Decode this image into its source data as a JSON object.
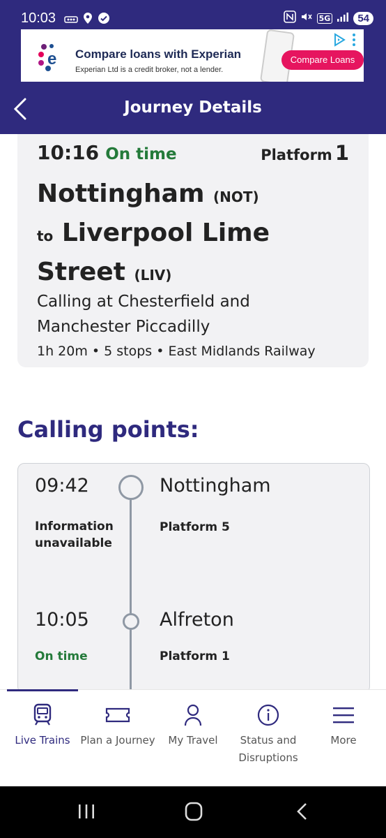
{
  "status_bar": {
    "time": "10:03",
    "battery": "54",
    "network": "5G"
  },
  "ad": {
    "title": "Compare loans with Experian",
    "subtitle": "Experian Ltd is a credit broker, not a lender.",
    "cta": "Compare Loans"
  },
  "header": {
    "title": "Journey Details"
  },
  "journey": {
    "departure_time": "10:16",
    "status": "On time",
    "platform_label": "Platform",
    "platform_number": "1",
    "origin": "Nottingham",
    "origin_code": "(NOT)",
    "to_word": "to",
    "destination": "Liverpool Lime Street",
    "destination_code": "(LIV)",
    "calling_at": "Calling at Chesterfield and Manchester Piccadilly",
    "meta": "1h 20m • 5 stops • East Midlands Railway"
  },
  "calling_points": {
    "heading": "Calling points:",
    "stops": [
      {
        "time": "09:42",
        "status": "Information unavailable",
        "name": "Nottingham",
        "platform": "Platform 5"
      },
      {
        "time": "10:05",
        "status": "On time",
        "name": "Alfreton",
        "platform": "Platform 1"
      }
    ]
  },
  "bottom_nav": {
    "items": [
      {
        "label": "Live Trains",
        "icon": "train-icon",
        "active": true
      },
      {
        "label": "Plan a Journey",
        "icon": "ticket-icon",
        "active": false
      },
      {
        "label": "My Travel",
        "icon": "person-icon",
        "active": false
      },
      {
        "label": "Status and Disruptions",
        "icon": "info-icon",
        "active": false
      },
      {
        "label": "More",
        "icon": "menu-icon",
        "active": false
      }
    ]
  },
  "colors": {
    "brand": "#2f2a7e",
    "on_time": "#247a3a",
    "card_bg": "#f2f2f4",
    "timeline": "#8f98a4"
  }
}
